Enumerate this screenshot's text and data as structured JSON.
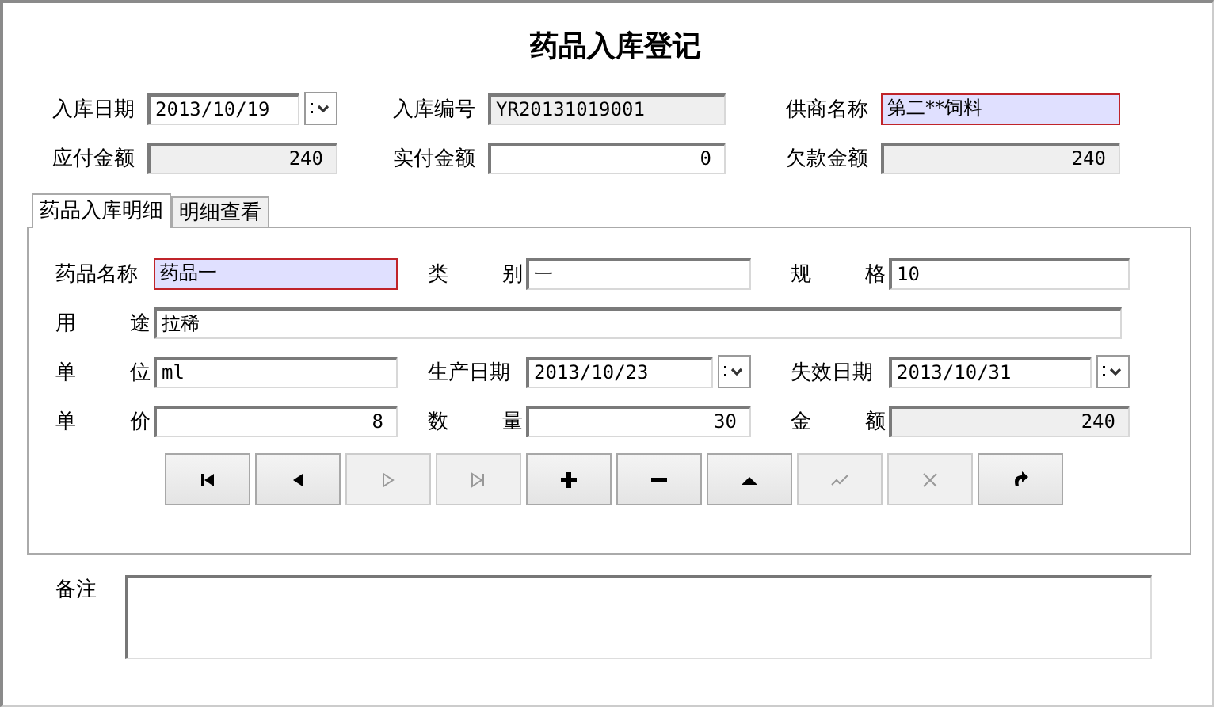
{
  "title": "药品入库登记",
  "header_rows": [
    [
      {
        "label": "入库日期",
        "value": "2013/10/19",
        "kind": "date",
        "readonly": false,
        "highlighted": false
      },
      {
        "label": "入库编号",
        "value": "YR20131019001",
        "kind": "text",
        "readonly": true,
        "highlighted": false
      },
      {
        "label": "供商名称",
        "value": "第二**饲料",
        "kind": "text",
        "readonly": false,
        "highlighted": true
      }
    ],
    [
      {
        "label": "应付金额",
        "value": "240",
        "kind": "number",
        "readonly": true,
        "highlighted": false
      },
      {
        "label": "实付金额",
        "value": "0",
        "kind": "number",
        "readonly": false,
        "highlighted": false
      },
      {
        "label": "欠款金额",
        "value": "240",
        "kind": "number",
        "readonly": true,
        "highlighted": false
      }
    ]
  ],
  "tabs": [
    {
      "label": "药品入库明细",
      "selected": true
    },
    {
      "label": "明细查看",
      "selected": false
    }
  ],
  "detail_rows": [
    [
      {
        "label": "药品名称",
        "value": "药品一",
        "kind": "text",
        "readonly": false,
        "highlighted": true
      },
      {
        "label": "类 别",
        "value": "一",
        "kind": "text",
        "readonly": false,
        "highlighted": false
      },
      {
        "label": "规 格",
        "value": "10",
        "kind": "text",
        "readonly": false,
        "highlighted": false
      }
    ],
    [
      {
        "label": "用 途",
        "value": "拉稀",
        "kind": "wide",
        "readonly": false,
        "highlighted": false
      }
    ],
    [
      {
        "label": "单 位",
        "value": "ml",
        "kind": "text",
        "readonly": false,
        "highlighted": false
      },
      {
        "label": "生产日期",
        "value": "2013/10/23",
        "kind": "date",
        "readonly": false,
        "highlighted": false
      },
      {
        "label": "失效日期",
        "value": "2013/10/31",
        "kind": "date",
        "readonly": false,
        "highlighted": false
      }
    ],
    [
      {
        "label": "单 价",
        "value": "8",
        "kind": "number",
        "readonly": false,
        "highlighted": false
      },
      {
        "label": "数 量",
        "value": "30",
        "kind": "number",
        "readonly": false,
        "highlighted": false
      },
      {
        "label": "金 额",
        "value": "240",
        "kind": "number",
        "readonly": true,
        "highlighted": false
      }
    ]
  ],
  "buttons": [
    {
      "kind": "first",
      "disabled": false
    },
    {
      "kind": "prev",
      "disabled": false
    },
    {
      "kind": "next",
      "disabled": true
    },
    {
      "kind": "last",
      "disabled": true
    },
    {
      "kind": "add",
      "disabled": false
    },
    {
      "kind": "delete",
      "disabled": false
    },
    {
      "kind": "up",
      "disabled": false
    },
    {
      "kind": "save",
      "disabled": true
    },
    {
      "kind": "cancel",
      "disabled": true
    },
    {
      "kind": "refresh",
      "disabled": false
    }
  ],
  "remarks": {
    "label": "备注"
  }
}
